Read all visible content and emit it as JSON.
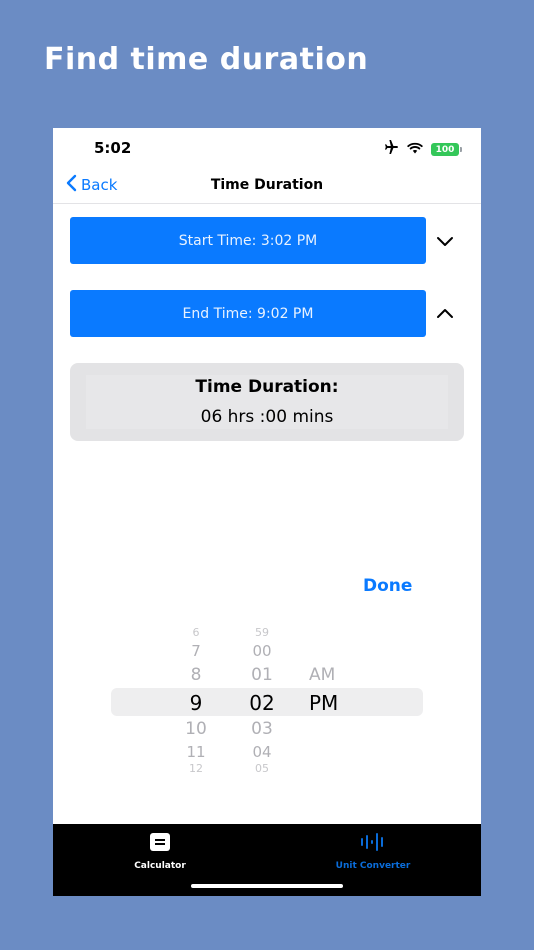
{
  "headline": "Find time duration",
  "status": {
    "time": "5:02",
    "battery": "100"
  },
  "nav": {
    "back_label": "Back",
    "title": "Time Duration"
  },
  "start_time": {
    "label": "Start Time: 3:02 PM"
  },
  "end_time": {
    "label": "End Time: 9:02 PM"
  },
  "duration": {
    "title": "Time Duration:",
    "value": "06 hrs :00 mins"
  },
  "done_label": "Done",
  "picker": {
    "hours": [
      "6",
      "7",
      "8",
      "9",
      "10",
      "11",
      "12"
    ],
    "minutes": [
      "59",
      "00",
      "01",
      "02",
      "03",
      "04",
      "05"
    ],
    "ampm": [
      "AM",
      "PM"
    ],
    "selected": {
      "hour": "9",
      "minute": "02",
      "period": "PM"
    }
  },
  "tabs": [
    {
      "label": "Calculator",
      "icon": "calculator-icon",
      "color": "#ffffff"
    },
    {
      "label": "Unit Converter",
      "icon": "waveform-icon",
      "color": "#0a6cd9"
    }
  ],
  "colors": {
    "accent": "#0a7aff",
    "background": "#6b8cc4",
    "battery": "#34c759"
  }
}
